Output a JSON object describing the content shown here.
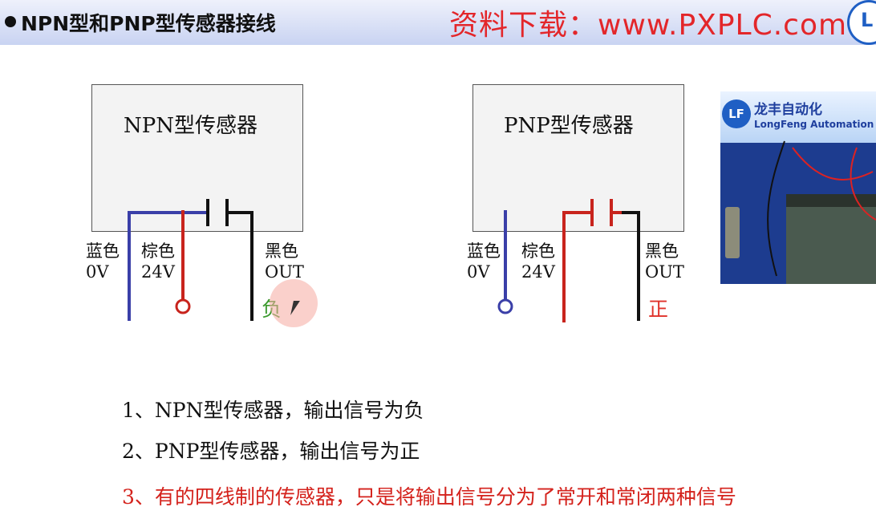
{
  "header": {
    "title": "NPN型和PNP型传感器接线",
    "banner": "资料下载：www.PXPLC.com",
    "logo_text": "L"
  },
  "npn": {
    "box_label": "NPN型传感器",
    "wires": [
      {
        "color_name": "蓝色",
        "value": "0V"
      },
      {
        "color_name": "棕色",
        "value": "24V"
      },
      {
        "color_name": "黑色",
        "value": "OUT"
      }
    ],
    "output_sign": "负"
  },
  "pnp": {
    "box_label": "PNP型传感器",
    "wires": [
      {
        "color_name": "蓝色",
        "value": "0V"
      },
      {
        "color_name": "棕色",
        "value": "24V"
      },
      {
        "color_name": "黑色",
        "value": "OUT"
      }
    ],
    "output_sign": "正"
  },
  "photo": {
    "brand_cn": "龙丰自动化",
    "brand_en": "LongFeng Automation",
    "logo": "LF"
  },
  "notes": [
    "1、NPN型传感器，输出信号为负",
    "2、PNP型传感器，输出信号为正",
    "3、有的四线制的传感器，只是将输出信号分为了常开和常闭两种信号"
  ],
  "colors": {
    "blue_wire": "#3a3fa8",
    "brown_wire": "#c8241d",
    "black_wire": "#111111",
    "negative_sign": "#3c9a2e",
    "positive_sign": "#e0322a",
    "note_red": "#d4221c",
    "banner_red": "#e3262a"
  }
}
